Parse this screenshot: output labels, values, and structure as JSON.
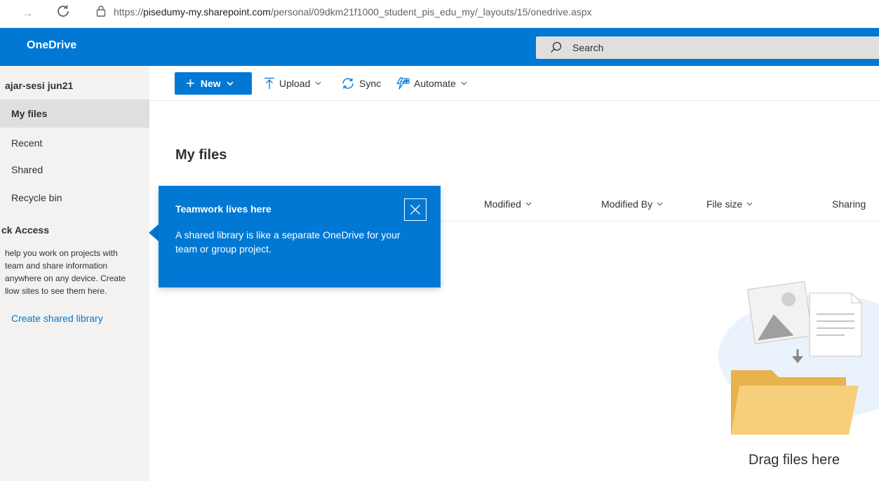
{
  "browser": {
    "url_prefix": "https://",
    "url_host": "pisedumy-my.sharepoint.com",
    "url_path": "/personal/09dkm21f1000_student_pis_edu_my/_layouts/15/onedrive.aspx"
  },
  "header": {
    "app_name": "OneDrive",
    "search_placeholder": "Search",
    "accent_color": "#0078d4"
  },
  "sidebar": {
    "user_name": "ajar-sesi jun21",
    "items": [
      {
        "label": "My files",
        "selected": true
      },
      {
        "label": "Recent",
        "selected": false
      },
      {
        "label": "Shared",
        "selected": false
      },
      {
        "label": "Recycle bin",
        "selected": false
      }
    ],
    "quick_access": {
      "heading": "ck Access",
      "description_lines": [
        "help you work on projects with",
        "team and share information",
        "anywhere on any device. Create",
        "llow sites to see them here."
      ],
      "create_link": "Create shared library"
    }
  },
  "toolbar": {
    "new_label": "New",
    "upload_label": "Upload",
    "sync_label": "Sync",
    "automate_label": "Automate"
  },
  "main": {
    "title": "My files",
    "columns": [
      "Modified",
      "Modified By",
      "File size",
      "Sharing"
    ],
    "empty_state": "Drag files here"
  },
  "callout": {
    "title": "Teamwork lives here",
    "body": "A shared library is like a separate OneDrive for your team or group project."
  }
}
